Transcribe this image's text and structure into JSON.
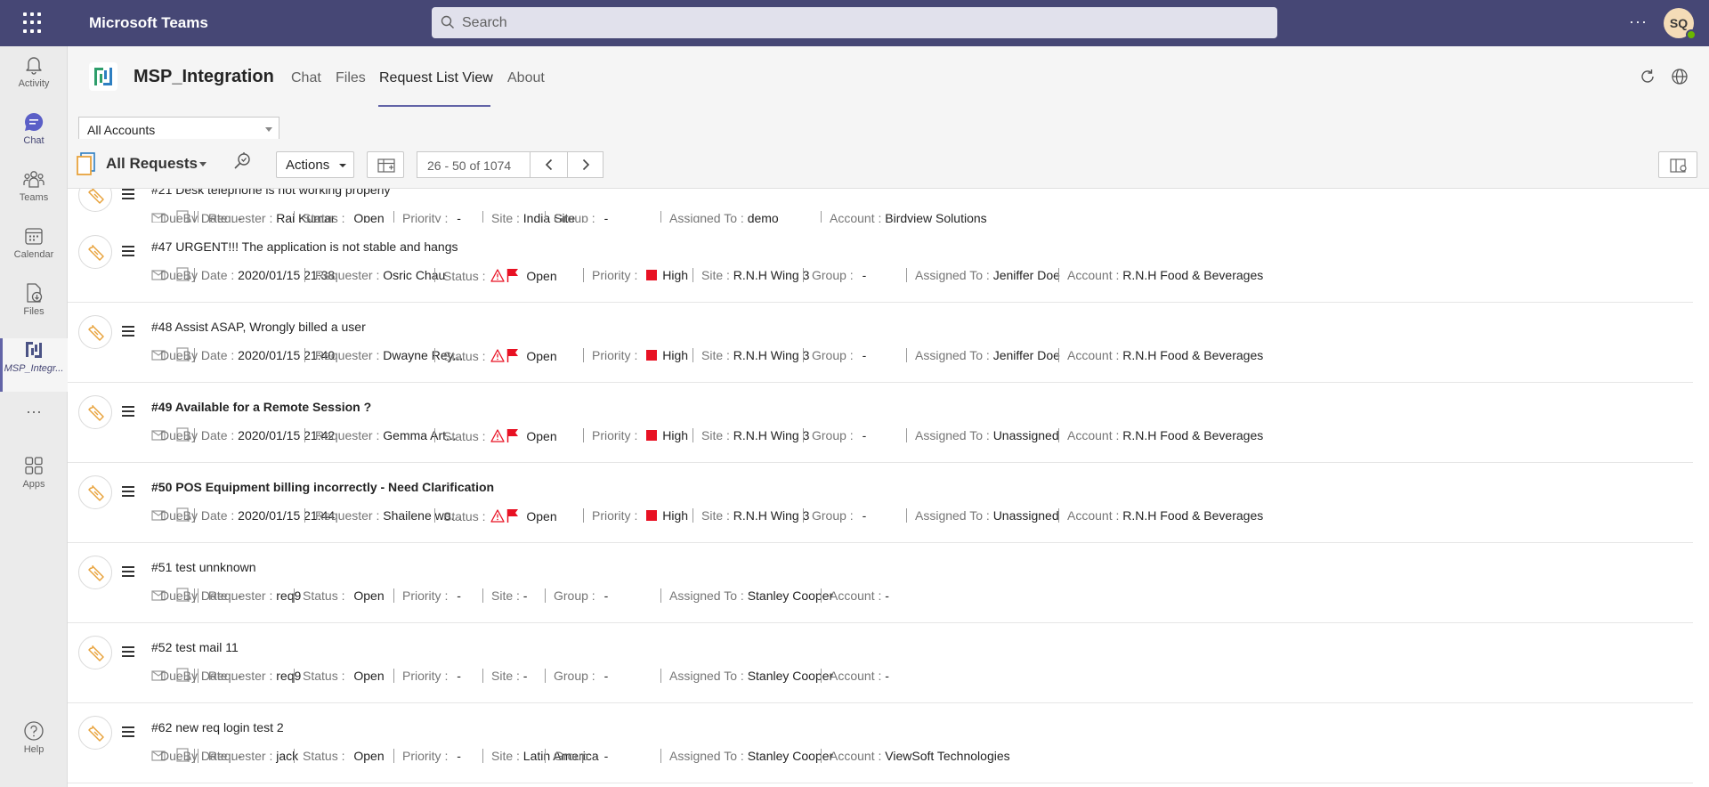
{
  "topbar": {
    "app_title": "Microsoft Teams",
    "search_placeholder": "Search",
    "more_label": "···",
    "avatar_initials": "SQ"
  },
  "rail": {
    "items": [
      {
        "label": "Activity",
        "icon": "bell-icon"
      },
      {
        "label": "Chat",
        "icon": "chat-icon"
      },
      {
        "label": "Teams",
        "icon": "teams-icon"
      },
      {
        "label": "Calendar",
        "icon": "calendar-icon"
      },
      {
        "label": "Files",
        "icon": "files-icon"
      },
      {
        "label": "MSP_Integr...",
        "icon": "msp-app-icon"
      },
      {
        "label": "···",
        "icon": "more-icon"
      },
      {
        "label": "Apps",
        "icon": "apps-icon"
      },
      {
        "label": "Help",
        "icon": "help-icon"
      }
    ]
  },
  "header": {
    "app_name": "MSP_Integration",
    "tabs": [
      {
        "label": "Chat"
      },
      {
        "label": "Files"
      },
      {
        "label": "Request List View"
      },
      {
        "label": "About"
      }
    ],
    "active_tab": "Request List View"
  },
  "account_filter": {
    "selected": "All Accounts"
  },
  "toolbar": {
    "view_label": "All Requests",
    "actions_label": "Actions",
    "pager_text": "26 - 50 of 1074"
  },
  "labels": {
    "due": "DueBy Date : ",
    "requester": "Requester : ",
    "status": "Status : ",
    "priority": "Priority : ",
    "site": "Site : ",
    "group": "Group : ",
    "assigned": "Assigned To : ",
    "account": "Account : "
  },
  "colors": {
    "brand": "#464775",
    "accent": "#6264a7",
    "priority_high": "#e81123",
    "warning": "#e81123",
    "ticket_icon": "#e8a33d"
  },
  "requests": [
    {
      "title": "#21 Desk telephone is not working properly",
      "bold": false,
      "due": "-",
      "requester": "Raj Kumar",
      "status": "Open",
      "status_flags": false,
      "priority": "-",
      "priority_flag": false,
      "site": "India Site",
      "group": "-",
      "assigned": "demo",
      "account": "Birdview Solutions"
    },
    {
      "title": "#47 URGENT!!! The application is not stable and hangs",
      "bold": false,
      "due": "2020/01/15 21:38",
      "requester": "Osric Chau",
      "status": "Open",
      "status_flags": true,
      "priority": "High",
      "priority_flag": true,
      "site": "R.N.H Wing 3",
      "group": "-",
      "assigned": "Jeniffer Doe",
      "account": "R.N.H Food & Beverages"
    },
    {
      "title": "#48 Assist ASAP, Wrongly billed a user",
      "bold": false,
      "due": "2020/01/15 21:40",
      "requester": "Dwayne Rey...",
      "status": "Open",
      "status_flags": true,
      "priority": "High",
      "priority_flag": true,
      "site": "R.N.H Wing 3",
      "group": "-",
      "assigned": "Jeniffer Doe",
      "account": "R.N.H Food & Beverages"
    },
    {
      "title": "#49 Available for a Remote Session ?",
      "bold": true,
      "due": "2020/01/15 21:42",
      "requester": "Gemma Art...",
      "status": "Open",
      "status_flags": true,
      "priority": "High",
      "priority_flag": true,
      "site": "R.N.H Wing 3",
      "group": "-",
      "assigned": "Unassigned",
      "account": "R.N.H Food & Beverages"
    },
    {
      "title": "#50 POS Equipment billing incorrectly - Need Clarification",
      "bold": true,
      "due": "2020/01/15 21:44",
      "requester": "Shailene wo...",
      "status": "Open",
      "status_flags": true,
      "priority": "High",
      "priority_flag": true,
      "site": "R.N.H Wing 3",
      "group": "-",
      "assigned": "Unassigned",
      "account": "R.N.H Food & Beverages"
    },
    {
      "title": "#51 test unnknown",
      "bold": false,
      "due": "-",
      "requester": "req9",
      "status": "Open",
      "status_flags": false,
      "priority": "-",
      "priority_flag": false,
      "site": "-",
      "group": "-",
      "assigned": "Stanley Cooper",
      "account": "-"
    },
    {
      "title": "#52 test mail 11",
      "bold": false,
      "due": "-",
      "requester": "req9",
      "status": "Open",
      "status_flags": false,
      "priority": "-",
      "priority_flag": false,
      "site": "-",
      "group": "-",
      "assigned": "Stanley Cooper",
      "account": "-"
    },
    {
      "title": "#62 new req login test 2",
      "bold": false,
      "due": "-",
      "requester": "jack",
      "status": "Open",
      "status_flags": false,
      "priority": "-",
      "priority_flag": false,
      "site": "Latin America",
      "group": "-",
      "assigned": "Stanley Cooper",
      "account": "ViewSoft Technologies"
    }
  ]
}
